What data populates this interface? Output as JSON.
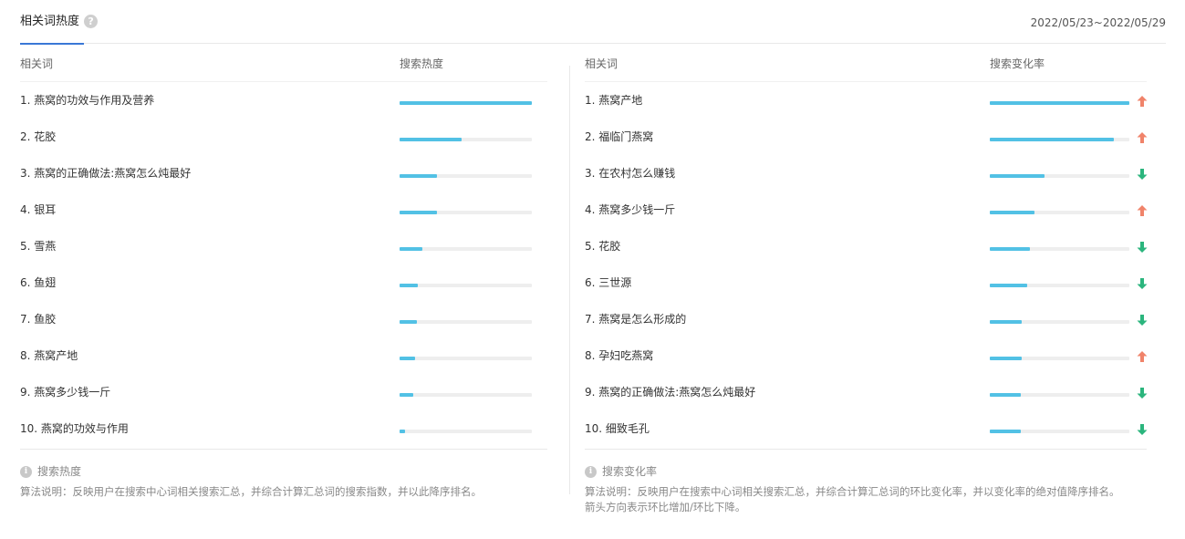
{
  "header": {
    "tab_label": "相关词热度",
    "help_icon": "?",
    "date_range": "2022/05/23~2022/05/29"
  },
  "left": {
    "col_term": "相关词",
    "col_metric": "搜索热度",
    "rows": [
      {
        "term": "1.  燕窝的功效与作用及营养",
        "level": 1.0
      },
      {
        "term": "2.  花胶",
        "level": 0.47
      },
      {
        "term": "3.  燕窝的正确做法:燕窝怎么炖最好",
        "level": 0.28
      },
      {
        "term": "4.  银耳",
        "level": 0.28
      },
      {
        "term": "5.  雪燕",
        "level": 0.17
      },
      {
        "term": "6.  鱼翅",
        "level": 0.14
      },
      {
        "term": "7.  鱼胶",
        "level": 0.13
      },
      {
        "term": "8.  燕窝产地",
        "level": 0.12
      },
      {
        "term": "9.  燕窝多少钱一斤",
        "level": 0.1
      },
      {
        "term": "10. 燕窝的功效与作用",
        "level": 0.04
      }
    ],
    "note_title": "搜索热度",
    "note_text": "算法说明：反映用户在搜索中心词相关搜索汇总，并综合计算汇总词的搜索指数，并以此降序排名。"
  },
  "right": {
    "col_term": "相关词",
    "col_metric": "搜索变化率",
    "rows": [
      {
        "term": "1.  燕窝产地",
        "level": 1.0,
        "trend": "up"
      },
      {
        "term": "2.  福临门燕窝",
        "level": 0.89,
        "trend": "up"
      },
      {
        "term": "3.  在农村怎么赚钱",
        "level": 0.39,
        "trend": "down"
      },
      {
        "term": "4.  燕窝多少钱一斤",
        "level": 0.32,
        "trend": "up"
      },
      {
        "term": "5.  花胶",
        "level": 0.29,
        "trend": "down"
      },
      {
        "term": "6.  三世源",
        "level": 0.27,
        "trend": "down"
      },
      {
        "term": "7.  燕窝是怎么形成的",
        "level": 0.23,
        "trend": "down"
      },
      {
        "term": "8.  孕妇吃燕窝",
        "level": 0.23,
        "trend": "up"
      },
      {
        "term": "9.  燕窝的正确做法:燕窝怎么炖最好",
        "level": 0.22,
        "trend": "down"
      },
      {
        "term": "10. 细致毛孔",
        "level": 0.22,
        "trend": "down"
      }
    ],
    "note_title": "搜索变化率",
    "note_text_line1": "算法说明：反映用户在搜索中心词相关搜索汇总，并综合计算汇总词的环比变化率，并以变化率的绝对值降序排名。",
    "note_text_line2": "箭头方向表示环比增加/环比下降。"
  },
  "colors": {
    "bar_fill": "#52c1e5",
    "bar_track": "#eeeeee",
    "trend_up": "#f0836a",
    "trend_down": "#2bb57d",
    "accent": "#3a78d6"
  },
  "icons": {
    "help": "question-mark-icon",
    "info": "info-icon",
    "up": "arrow-up-icon",
    "down": "arrow-down-icon"
  }
}
